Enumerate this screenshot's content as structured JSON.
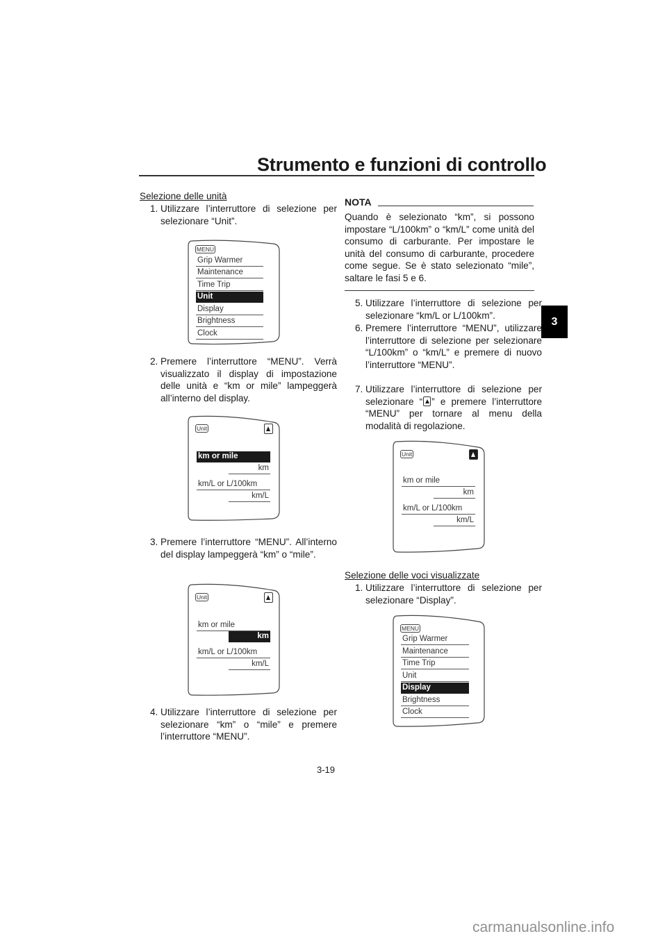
{
  "header": {
    "title": "Strumento e funzioni di controllo",
    "chapter_tab": "3"
  },
  "left": {
    "section1_heading": "Selezione delle unità",
    "steps": [
      {
        "num": "1.",
        "text": "Utilizzare l’interruttore di selezione per selezionare “Unit”."
      },
      {
        "num": "2.",
        "text": "Premere l’interruttore “MENU”. Verrà visualizzato il display di impostazione delle unità e “km or mile” lampeggerà all’interno del display."
      },
      {
        "num": "3.",
        "text": "Premere l’interruttore “MENU”. All’interno del display lampeggerà “km” o “mile”."
      },
      {
        "num": "4.",
        "text": "Utilizzare l’interruttore di selezione per selezionare “km” o “mile” e premere l’interruttore “MENU”."
      }
    ]
  },
  "right": {
    "nota": {
      "label": "NOTA",
      "text": "Quando è selezionato “km”, si possono impostare “L/100km” o “km/L” come unità del consumo di carburante. Per impostare le unità del consumo di carburante, procedere come segue. Se è stato selezionato “mile”, saltare le fasi 5 e 6."
    },
    "steps": [
      {
        "num": "5.",
        "text": "Utilizzare l’interruttore di selezione per selezionare “km/L or L/100km”."
      },
      {
        "num": "6.",
        "text": "Premere l’interruttore “MENU”, utilizzare l’interruttore di selezione per selezionare “L/100km” o “km/L” e premere di nuovo l’interruttore “MENU”."
      },
      {
        "num": "7.",
        "text_before": "Utilizzare l’interruttore di selezione per selezionare “",
        "text_after": "” e premere l’interruttore “MENU” per tornare al menu della modalità di regolazione."
      }
    ],
    "section2_heading": "Selezione delle voci visualizzate",
    "section2_steps": [
      {
        "num": "1.",
        "text": "Utilizzare l’interruttore di selezione per selezionare “Display”."
      }
    ]
  },
  "displays": {
    "menu_tag": "MENU",
    "unit_tag": "Unit",
    "menu_items": [
      "Grip Warmer",
      "Maintenance",
      "Time Trip",
      "Unit",
      "Display",
      "Brightness",
      "Clock"
    ],
    "unit_rows": {
      "distance_label": "km or mile",
      "distance_value": "km",
      "fuel_label": "km/L or L/100km",
      "fuel_value": "km/L"
    },
    "menu1_selected": "Unit",
    "menu2_selected": "Display",
    "unit_display_1_selected": "km or mile",
    "unit_display_2_selected": "km",
    "unit_display_3_selected": "return-arrow"
  },
  "footer": {
    "page_number": "3-19",
    "watermark": "carmanualsonline.info"
  }
}
